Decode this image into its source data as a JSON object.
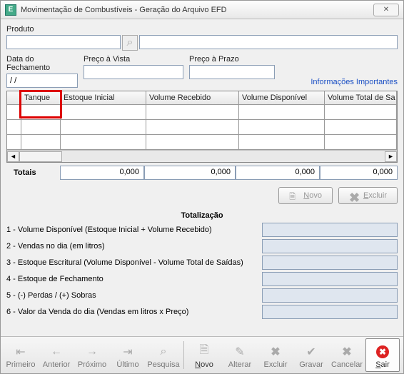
{
  "window": {
    "icon_letter": "E",
    "title": "Movimentação de Combustíveis - Geração do Arquivo EFD",
    "close_glyph": "✕"
  },
  "labels": {
    "produto": "Produto",
    "data_fechamento": "Data do Fechamento",
    "preco_vista": "Preço à Vista",
    "preco_prazo": "Preço à Prazo",
    "info_link": "Informações Importantes",
    "totais": "Totais",
    "totalizacao": "Totalização"
  },
  "fields": {
    "data_fechamento": "/ /"
  },
  "grid": {
    "columns": [
      "",
      "Tanque",
      "Estoque Inicial",
      "Volume Recebido",
      "Volume Disponível",
      "Volume Total de Sa"
    ],
    "row_count": 3
  },
  "totals_values": [
    "0,000",
    "0,000",
    "0,000",
    "0,000"
  ],
  "buttons": {
    "novo": "Novo",
    "excluir": "Excluir"
  },
  "total_lines": [
    "1 - Volume Disponível (Estoque Inicial + Volume Recebido)",
    "2 - Vendas no dia (em litros)",
    "3 - Estoque Escritural (Volume Disponível - Volume Total de Saídas)",
    "4 - Estoque de Fechamento",
    "5 - (-) Perdas / (+) Sobras",
    "6 - Valor da Venda do dia (Vendas em litros x Preço)"
  ],
  "toolbar": {
    "primeiro": "Primeiro",
    "anterior": "Anterior",
    "proximo": "Próximo",
    "ultimo": "Último",
    "pesquisa": "Pesquisa",
    "novo": "Novo",
    "alterar": "Alterar",
    "excluir": "Excluir",
    "gravar": "Gravar",
    "cancelar": "Cancelar",
    "sair": "Sair"
  }
}
